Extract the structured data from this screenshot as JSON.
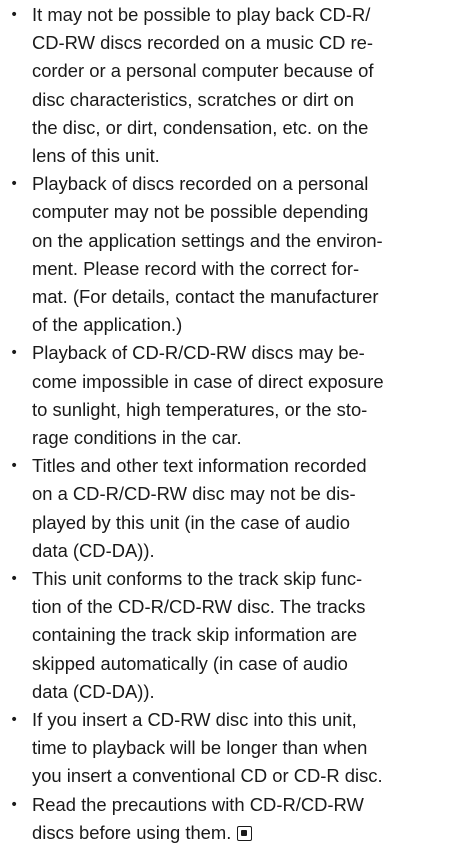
{
  "bullets": [
    {
      "lines": [
        "It may not be possible to play back CD-R/",
        "CD-RW discs recorded on a music CD re-",
        "corder or a personal computer because of",
        "disc characteristics, scratches or dirt on",
        "the disc, or dirt, condensation, etc. on the",
        "lens of this unit."
      ]
    },
    {
      "lines": [
        "Playback of discs recorded on a personal",
        "computer may not be possible depending",
        "on the application settings and the environ-",
        "ment. Please record with the correct for-",
        "mat. (For details, contact the manufacturer",
        "of the application.)"
      ]
    },
    {
      "lines": [
        "Playback of CD-R/CD-RW discs may be-",
        "come impossible in case of direct exposure",
        "to sunlight, high temperatures, or the sto-",
        "rage conditions in the car."
      ]
    },
    {
      "lines": [
        "Titles and other text information recorded",
        "on a CD-R/CD-RW disc may not be dis-",
        "played by this unit (in the case of audio",
        "data (CD-DA))."
      ]
    },
    {
      "lines": [
        "This unit conforms to the track skip func-",
        "tion of the CD-R/CD-RW disc. The tracks",
        "containing the track skip information are",
        "skipped automatically (in case of audio",
        "data (CD-DA))."
      ]
    },
    {
      "lines": [
        "If you insert a CD-RW disc into this unit,",
        "time to playback will be longer than when",
        "you insert a conventional CD or CD-R disc."
      ]
    },
    {
      "lines": [
        "Read the precautions with CD-R/CD-RW",
        "discs before using them."
      ]
    }
  ],
  "bullet_glyph": "•",
  "end_mark_icon": "end-of-section-square-icon"
}
